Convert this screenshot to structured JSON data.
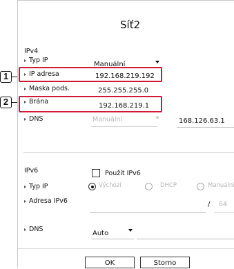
{
  "callouts": [
    "1",
    "2"
  ],
  "dialog": {
    "title": "Síť2",
    "ipv4": {
      "section_label": "IPv4",
      "ip_type": {
        "label": "Typ IP",
        "value": "Manuální"
      },
      "ip_address": {
        "label": "IP adresa",
        "value": "192.168.219.192"
      },
      "subnet_mask": {
        "label": "Maska pods.",
        "value": "255.255.255.0"
      },
      "gateway": {
        "label": "Brána",
        "value": "192.168.219.1"
      },
      "dns": {
        "label": "DNS",
        "mode": "Manuální",
        "value": "168.126.63.1"
      }
    },
    "ipv6": {
      "section_label": "IPv6",
      "use_ipv6": {
        "label": "Použít IPv6",
        "checked": false
      },
      "ip_type": {
        "label": "Typ IP",
        "options": [
          "Výchozí",
          "DHCP",
          "Manuální"
        ],
        "selected": "Výchozí"
      },
      "address": {
        "label": "Adresa IPv6",
        "separator": "/",
        "prefix": "64"
      },
      "dns": {
        "label": "DNS",
        "value": "Auto"
      }
    },
    "buttons": {
      "ok": "OK",
      "cancel": "Storno"
    }
  },
  "colors": {
    "highlight": "#d01934",
    "muted_text": "#b5b5b5"
  },
  "icons": {
    "dropdown": "chevron-down-icon",
    "row_marker": "triangle-right-icon"
  }
}
